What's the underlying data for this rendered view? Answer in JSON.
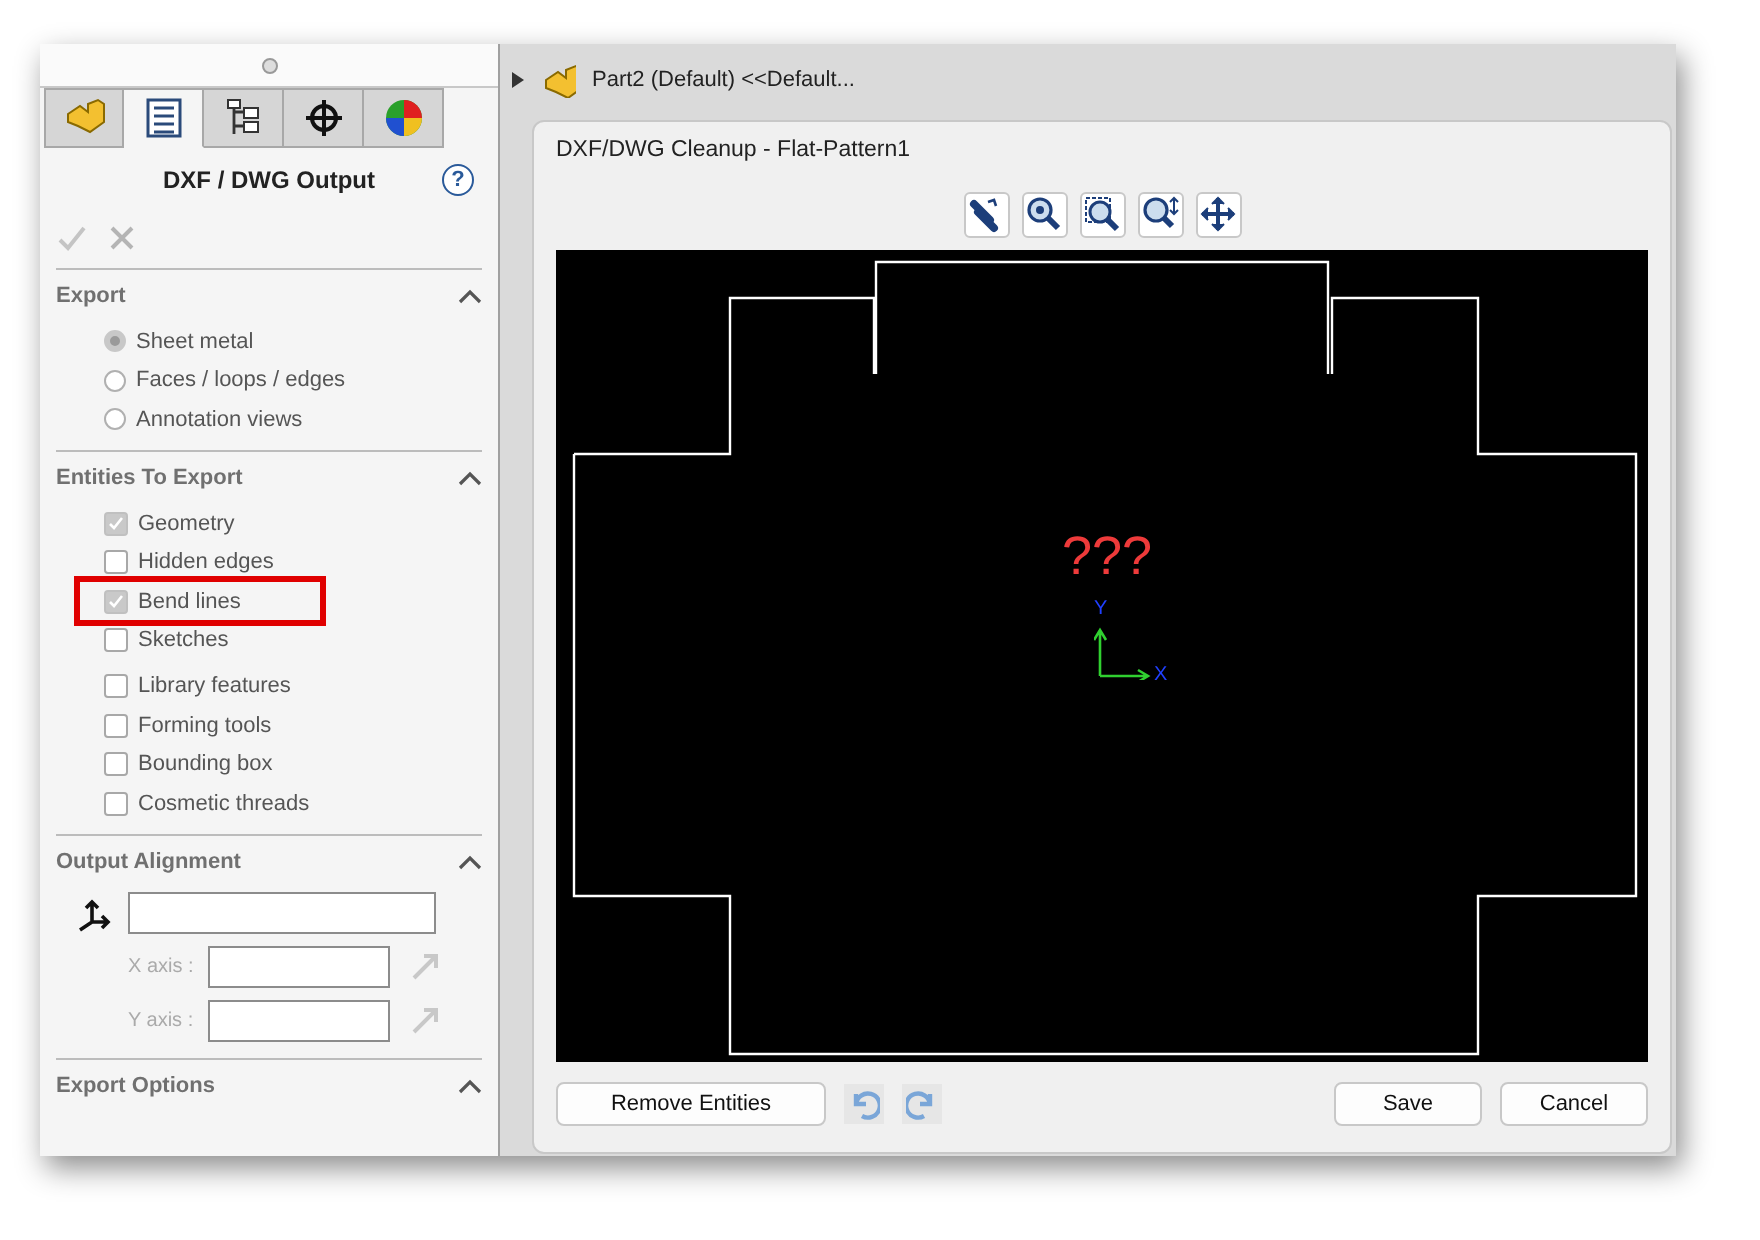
{
  "panel": {
    "tabs": [
      {
        "kind": "part",
        "selected": false
      },
      {
        "kind": "properties",
        "selected": true
      },
      {
        "kind": "config",
        "selected": false
      },
      {
        "kind": "target",
        "selected": false
      },
      {
        "kind": "appearance",
        "selected": false
      }
    ],
    "title": "DXF / DWG Output",
    "help": "?",
    "sections": [
      {
        "title": "Export",
        "expanded": true,
        "groups": [
          [
            {
              "kind": "radio",
              "label": "Sheet metal",
              "selected": true,
              "highlighted": false
            },
            {
              "kind": "radio",
              "label": "Faces / loops / edges",
              "selected": false,
              "highlighted": false
            },
            {
              "kind": "radio",
              "label": "Annotation views",
              "selected": false,
              "highlighted": false
            }
          ]
        ]
      },
      {
        "title": "Entities To Export",
        "expanded": true,
        "groups": [
          [
            {
              "kind": "checkbox",
              "label": "Geometry",
              "checked": true,
              "highlighted": false
            },
            {
              "kind": "checkbox",
              "label": "Hidden edges",
              "checked": false,
              "highlighted": false
            },
            {
              "kind": "checkbox",
              "label": "Bend lines",
              "checked": true,
              "highlighted": true
            },
            {
              "kind": "checkbox",
              "label": "Sketches",
              "checked": false,
              "highlighted": false
            }
          ],
          [
            {
              "kind": "checkbox",
              "label": "Library features",
              "checked": false,
              "highlighted": false
            },
            {
              "kind": "checkbox",
              "label": "Forming tools",
              "checked": false,
              "highlighted": false
            },
            {
              "kind": "checkbox",
              "label": "Bounding box",
              "checked": false,
              "highlighted": false
            },
            {
              "kind": "checkbox",
              "label": "Cosmetic threads",
              "checked": false,
              "highlighted": false
            }
          ]
        ]
      },
      {
        "title": "Output Alignment",
        "expanded": true,
        "groups": [
          [
            {
              "kind": "origin"
            },
            {
              "kind": "axis",
              "label": "X axis :"
            },
            {
              "kind": "axis",
              "label": "Y axis :"
            }
          ]
        ]
      },
      {
        "title": "Export Options",
        "expanded": true
      }
    ]
  },
  "breadcrumb": "Part2 (Default) <<Default...",
  "dialog": {
    "title": "DXF/DWG Cleanup - Flat-Pattern1",
    "tools": [
      {
        "kind": "select"
      },
      {
        "kind": "zoom-fit"
      },
      {
        "kind": "zoom-area"
      },
      {
        "kind": "zoom-inout"
      },
      {
        "kind": "pan"
      }
    ],
    "canvas_label": "???",
    "axis_x": "X",
    "axis_y": "Y",
    "buttons": [
      {
        "kind": "text",
        "label": "Remove Entities"
      },
      {
        "kind": "undo"
      },
      {
        "kind": "redo"
      },
      {
        "kind": "spacer"
      },
      {
        "kind": "text",
        "label": "Save"
      },
      {
        "kind": "text",
        "label": "Cancel"
      }
    ]
  }
}
